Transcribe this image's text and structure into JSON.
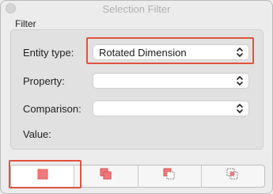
{
  "window": {
    "title": "Selection Filter"
  },
  "filter": {
    "group_label": "Filter",
    "rows": [
      {
        "label": "Entity type:",
        "value": "Rotated Dimension"
      },
      {
        "label": "Property:",
        "value": ""
      },
      {
        "label": "Comparison:",
        "value": ""
      },
      {
        "label": "Value:"
      }
    ]
  },
  "toolbar": {
    "buttons": [
      {
        "icon": "select-single-icon",
        "active": true
      },
      {
        "icon": "select-add-icon"
      },
      {
        "icon": "select-subtract-icon"
      },
      {
        "icon": "select-intersect-icon"
      }
    ]
  },
  "colors": {
    "highlight": "#e0533f",
    "icon_fill": "#f2797a"
  }
}
